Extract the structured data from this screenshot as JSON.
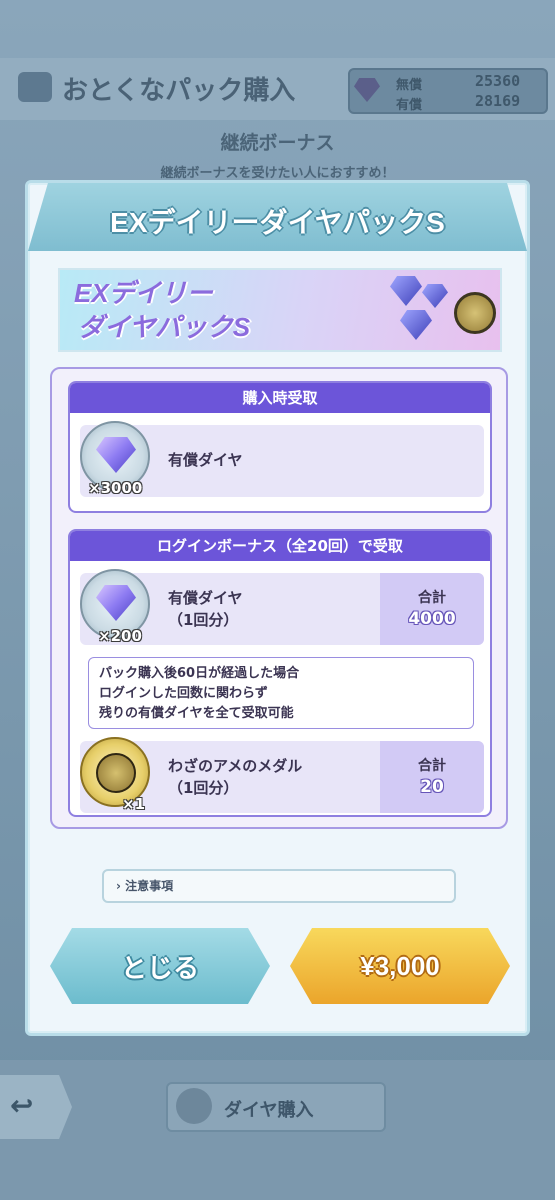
{
  "background": {
    "header_title": "おとくなパック購入",
    "currency": {
      "free_label": "無償",
      "free_value": "25360",
      "paid_label": "有償",
      "paid_value": "28169"
    },
    "section_title": "継続ボーナス",
    "section_sub": "継続ボーナスを受けたい人におすすめ！",
    "back_icon": "back-arrow-icon",
    "buy_diamond_label": "ダイヤ購入"
  },
  "modal": {
    "title": "EXデイリーダイヤパックS",
    "banner_title_line1": "EXデイリー",
    "banner_title_line2": "ダイヤパックS",
    "purchase_section": {
      "header": "購入時受取",
      "item_name": "有償ダイヤ",
      "quantity": "×3000"
    },
    "login_section": {
      "header": "ログインボーナス（全20回）で受取",
      "items": [
        {
          "name_line1": "有償ダイヤ",
          "name_line2": "（1回分）",
          "quantity": "×200",
          "total_label": "合計",
          "total_value": "4000"
        },
        {
          "name_line1": "わざのアメのメダル",
          "name_line2": "（1回分）",
          "quantity": "×1",
          "total_label": "合計",
          "total_value": "20"
        }
      ],
      "note_lines": [
        "パック購入後60日が経過した場合",
        "ログインした回数に関わらず",
        "残りの有償ダイヤを全て受取可能"
      ]
    },
    "caution_label": "注意事項",
    "close_button": "とじる",
    "price_button": "¥3,000"
  },
  "colors": {
    "accent_purple": "#6c55d9",
    "close_button": "#6cbccd",
    "buy_button": "#eba52b"
  }
}
